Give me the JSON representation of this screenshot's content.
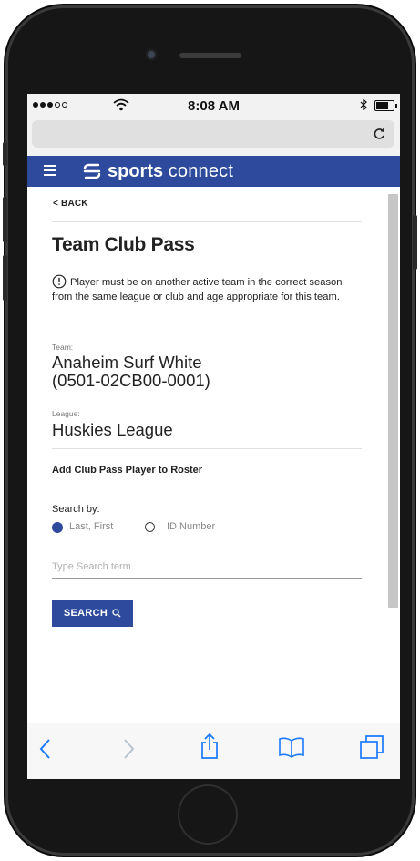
{
  "status_bar": {
    "time": "8:08 AM",
    "signal_dots": [
      true,
      true,
      true,
      false,
      false
    ]
  },
  "browser": {
    "reload_icon": "reload-icon"
  },
  "nav": {
    "brand_bold": "sports",
    "brand_light": "connect",
    "brand_color": "#2d4a9d"
  },
  "page": {
    "back_label": "< BACK",
    "title": "Team Club Pass",
    "notice": "Player must be on another active team in the correct season from the same league or club and age appropriate for this team.",
    "team_label": "Team:",
    "team_name": "Anaheim Surf White",
    "team_code": "(0501-02CB00-0001)",
    "league_label": "League:",
    "league_name": "Huskies League",
    "section_title": "Add Club Pass Player to Roster",
    "search_by_label": "Search by:",
    "search_options": [
      {
        "label": "Last, First",
        "selected": true
      },
      {
        "label": "ID Number",
        "selected": false
      }
    ],
    "search_placeholder": "Type Search term",
    "search_button": "SEARCH"
  },
  "toolbar": {
    "icons": [
      "back-arrow-icon",
      "forward-arrow-icon",
      "share-icon",
      "bookmarks-icon",
      "tabs-icon"
    ],
    "accent": "#1a7aff"
  }
}
